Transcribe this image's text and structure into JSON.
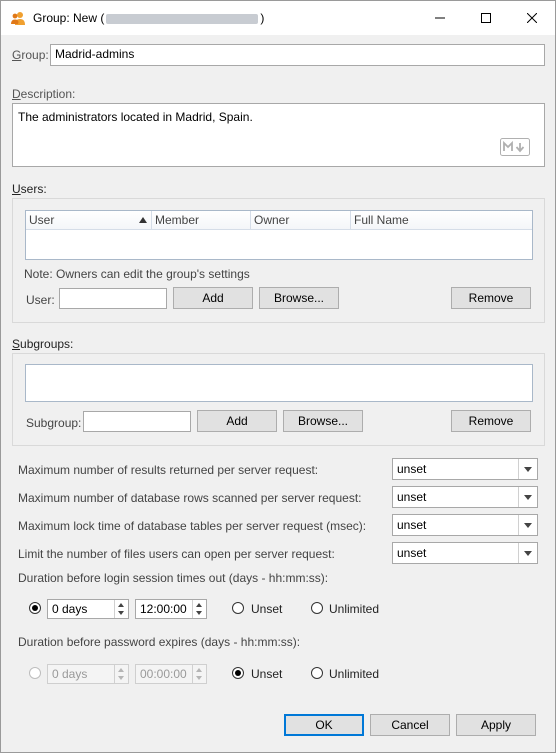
{
  "window": {
    "title_prefix": "Group: New (",
    "title_suffix": ")",
    "minimize_icon": "minimize-icon",
    "maximize_icon": "maximize-icon",
    "close_icon": "close-icon"
  },
  "group": {
    "label": "Group:",
    "value": "Madrid-admins"
  },
  "description": {
    "label": "Description:",
    "value": "The administrators located in Madrid, Spain.",
    "markdown_icon": "markdown-icon"
  },
  "users": {
    "label": "Users:",
    "columns": [
      "User",
      "Member",
      "Owner",
      "Full Name"
    ],
    "sort_icon": "sort-ascending-icon",
    "note": "Note: Owners can edit the group's settings",
    "user_label": "User:",
    "user_value": "",
    "add_label": "Add",
    "browse_label": "Browse...",
    "remove_label": "Remove"
  },
  "subgroups": {
    "label": "Subgroups:",
    "subgroup_label": "Subgroup:",
    "subgroup_value": "",
    "add_label": "Add",
    "browse_label": "Browse...",
    "remove_label": "Remove"
  },
  "limits": [
    {
      "label": "Maximum number of results returned per server request:",
      "value": "unset"
    },
    {
      "label": "Maximum number of database rows scanned per server request:",
      "value": "unset"
    },
    {
      "label": "Maximum lock time of database tables per server request (msec):",
      "value": "unset"
    },
    {
      "label": "Limit the number of files users can open per server request:",
      "value": "unset"
    }
  ],
  "session": {
    "label": "Duration before login session times out (days - hh:mm:ss):",
    "days": "0 days",
    "time": "12:00:00",
    "unset_label": "Unset",
    "unlimited_label": "Unlimited",
    "selected": "custom"
  },
  "password": {
    "label": "Duration before password expires (days - hh:mm:ss):",
    "days": "0 days",
    "time": "00:00:00",
    "unset_label": "Unset",
    "unlimited_label": "Unlimited",
    "selected": "unset"
  },
  "footer": {
    "ok_label": "OK",
    "cancel_label": "Cancel",
    "apply_label": "Apply"
  }
}
